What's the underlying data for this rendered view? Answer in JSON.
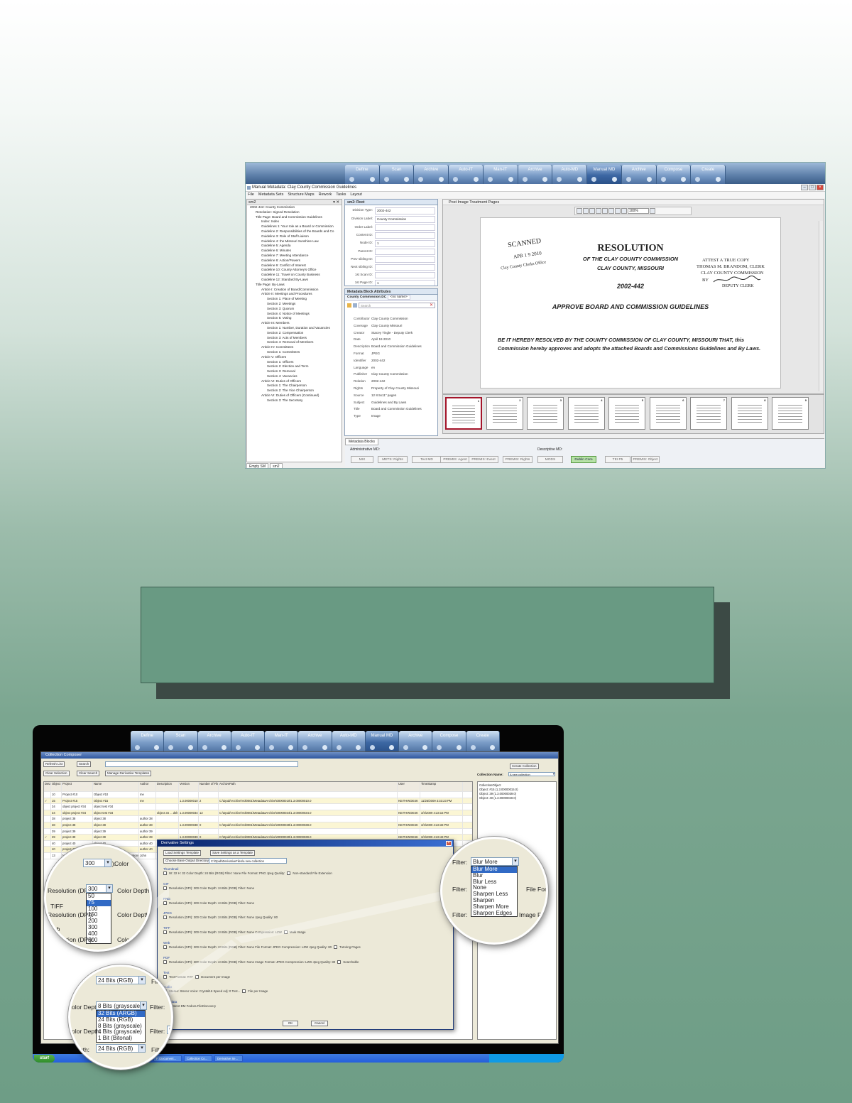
{
  "workflow_steps": [
    {
      "label": "Define",
      "dark": false
    },
    {
      "label": "Scan",
      "dark": false
    },
    {
      "label": "Archive",
      "dark": false
    },
    {
      "label": "Auto-IT",
      "dark": false
    },
    {
      "label": "Man-IT",
      "dark": false
    },
    {
      "label": "Archive",
      "dark": false
    },
    {
      "label": "Auto-MD",
      "dark": false
    },
    {
      "label": "Manual MD",
      "dark": true
    },
    {
      "label": "Archive",
      "dark": false
    },
    {
      "label": "Compose",
      "dark": false
    },
    {
      "label": "Create",
      "dark": false
    }
  ],
  "app1": {
    "window_title": "Manual Metadata: Clay County Commission Guidelines",
    "menu": [
      "File",
      "Metadata Sets",
      "Structure Maps",
      "Rework",
      "Tasks",
      "Layout"
    ],
    "tree_header": "sm2",
    "tree": [
      {
        "t": "2002-442: County Commission",
        "d": 1
      },
      {
        "t": "Resolution: Signed Resolution",
        "d": 2
      },
      {
        "t": "Title Page: Board and Commission Guidelines",
        "d": 2
      },
      {
        "t": "Index: Index",
        "d": 3
      },
      {
        "t": "Guidelines 1: Your role as a Board or Commission",
        "d": 3
      },
      {
        "t": "Guideline 2: Responsibilities of the Boards and Co",
        "d": 3
      },
      {
        "t": "Guideline 3: Role of Staff Liaison",
        "d": 3
      },
      {
        "t": "Guideline 4: the Missouri Sunshine Law",
        "d": 3
      },
      {
        "t": "Guideline 5: Agenda",
        "d": 3
      },
      {
        "t": "Guideline 6: Minutes",
        "d": 3
      },
      {
        "t": "Guideline 7: Meeting Attendance",
        "d": 3
      },
      {
        "t": "Guideline 8: Action/Powers",
        "d": 3
      },
      {
        "t": "Guideline 9: Conflict of Interest",
        "d": 3
      },
      {
        "t": "Guideline 10: County Attorney's Office",
        "d": 3
      },
      {
        "t": "Guideline 11: Travel on County Business",
        "d": 3
      },
      {
        "t": "Guideline 12: Standard By-Laws",
        "d": 3
      },
      {
        "t": "Title Page: By-Laws",
        "d": 2
      },
      {
        "t": "Article I: Creation of Board/Commission",
        "d": 3
      },
      {
        "t": "Article II: Meetings and Procedures",
        "d": 3
      },
      {
        "t": "Section 1: Place of Meeting",
        "d": 4
      },
      {
        "t": "Section 2: Meetings",
        "d": 4
      },
      {
        "t": "Section 3: Quorum",
        "d": 4
      },
      {
        "t": "Section 4: Notice of Meetings",
        "d": 4
      },
      {
        "t": "Section 5: Voting",
        "d": 4
      },
      {
        "t": "Article III: Members",
        "d": 3
      },
      {
        "t": "Section 1: Number, Duration and Vacancies",
        "d": 4
      },
      {
        "t": "Section 2: Compensation",
        "d": 4
      },
      {
        "t": "Section 3: Acts of Members",
        "d": 4
      },
      {
        "t": "Section 4: Removal of Members",
        "d": 4
      },
      {
        "t": "Article IV: Committees",
        "d": 3
      },
      {
        "t": "Section 1: Committees",
        "d": 4
      },
      {
        "t": "Article V: Officers",
        "d": 3
      },
      {
        "t": "Section 1: Officers",
        "d": 4
      },
      {
        "t": "Section 2: Election and Term",
        "d": 4
      },
      {
        "t": "Section 3: Removal",
        "d": 4
      },
      {
        "t": "Section 4: Vacancies",
        "d": 4
      },
      {
        "t": "Article VI: Duties of Officers",
        "d": 3
      },
      {
        "t": "Section 1: The Chairperson",
        "d": 4
      },
      {
        "t": "Section 2: The Vice Chairperson",
        "d": 4
      },
      {
        "t": "Article VI: Duties of Officers (Continued)",
        "d": 3
      },
      {
        "t": "Section 3: The Secretary",
        "d": 4
      }
    ],
    "tree_tabs": [
      "Empty SM",
      "sm2"
    ],
    "root_panel": {
      "title": "sm2: Root",
      "fields": [
        {
          "k": "Division Type:",
          "v": "2002-442"
        },
        {
          "k": "Division Label:",
          "v": "County Commission"
        },
        {
          "k": "Order Label:",
          "v": ""
        },
        {
          "k": "Content ID:",
          "v": ""
        },
        {
          "k": "Node ID:",
          "v": "1"
        },
        {
          "k": "Parent ID:",
          "v": ""
        },
        {
          "k": "Prev sibling ID:",
          "v": ""
        },
        {
          "k": "Next sibling ID:",
          "v": ""
        },
        {
          "k": "1st Scan ID:",
          "v": ""
        },
        {
          "k": "1st Page ID:",
          "v": "1"
        }
      ]
    },
    "block_panel": {
      "title": "Metadata Block Attributes",
      "tab": "County Commission:DC",
      "name_placeholder": "<no name>",
      "search_placeholder": "Search",
      "fields": [
        {
          "k": "Contributor",
          "v": "Clay County Commission"
        },
        {
          "k": "Coverage",
          "v": "Clay County Missouri"
        },
        {
          "k": "Creator",
          "v": "Stacey Tingle - Deputy Clerk"
        },
        {
          "k": "Date",
          "v": "April 19 2010"
        },
        {
          "k": "Description",
          "v": "Board and Commission Guidelines"
        },
        {
          "k": "Format",
          "v": "JPEG"
        },
        {
          "k": "Identifier",
          "v": "2002-442"
        },
        {
          "k": "Language",
          "v": "en"
        },
        {
          "k": "Publisher",
          "v": "Clay County Commission"
        },
        {
          "k": "Relation",
          "v": "2002-442"
        },
        {
          "k": "Rights",
          "v": "Property of Clay County Missouri"
        },
        {
          "k": "Source",
          "v": "12 8.5x11\" pages"
        },
        {
          "k": "Subject",
          "v": "Guidelines and By Laws"
        },
        {
          "k": "Title",
          "v": "Board and Commission Guidelines"
        },
        {
          "k": "Type",
          "v": "Image"
        }
      ]
    },
    "viewer": {
      "title": "Post Image Treatment Pages",
      "zoom": "100%",
      "document": {
        "stamp1": "SCANNED",
        "stamp2": "APR 1 9 2010",
        "stamp3": "Clay County Clerks Office",
        "heading": "RESOLUTION",
        "sub1": "OF THE CLAY COUNTY COMMISSION",
        "sub2": "CLAY COUNTY, MISSOURI",
        "number": "2002-442",
        "attest1": "ATTEST A TRUE COPY",
        "attest2": "THOMAS M. BRANDOM, CLERK",
        "attest3": "CLAY COUNTY COMMISSION",
        "attest4": "BY",
        "attest5": "DEPUTY CLERK",
        "approve": "APPROVE BOARD AND COMMISSION GUIDELINES",
        "body": "BE IT HEREBY RESOLVED BY THE COUNTY COMMISSION OF CLAY COUNTY, MISSOURI THAT, this Commission hereby approves and adopts the attached Boards and Commissions Guidelines and By Laws."
      },
      "thumb_numbers": [
        "1",
        "2",
        "3",
        "4",
        "5",
        "6",
        "7",
        "8",
        "9"
      ]
    },
    "metadata_blocks": {
      "tab": "Metadata Blocks",
      "admin_label": "Administrative MD:",
      "desc_label": "Descriptive MD:",
      "admin": [
        "MIX",
        "METS: Rights",
        "Text MD",
        "PREMIS: Agent",
        "PREMIS: Event",
        "PREMIS: Rights"
      ],
      "desc": [
        {
          "l": "MODS",
          "s": false
        },
        {
          "l": "Dublin Core",
          "s": true
        },
        {
          "l": "TEI P5",
          "s": false
        },
        {
          "l": "PREMIS: Object",
          "s": false
        }
      ]
    }
  },
  "app2": {
    "window_title": "Collection Composer",
    "buttons": {
      "refresh": "Refresh List",
      "search": "Search",
      "clear_selection": "Clear Selection",
      "clear_search": "Clear Search",
      "manage": "Manage Derivative Templates",
      "create": "Create Collection"
    },
    "collection_name_label": "Collection Name:",
    "collection_name_value": "A new collection",
    "columns": [
      "Detail",
      "Object ID",
      "Project",
      "Name",
      "Author",
      "Description",
      "Version",
      "Number of Files",
      "ArchivePath",
      "User",
      "TimeStamp"
    ],
    "rows": [
      [
        "",
        "10",
        "Project #10",
        "Object #10",
        "me",
        "",
        "",
        "",
        "",
        "",
        ""
      ],
      [
        "✓",
        "15",
        "Project #15",
        "Object #15",
        "me",
        "",
        "1.3.00000010.0",
        "2",
        "C:\\Dpub\\Archive\\Vol0001\\MetadataArchive\\00000010\\1.3.00000010.0",
        "KEITHWOESK",
        "11/25/2009 3:33:23 PM"
      ],
      [
        "",
        "34",
        "object project #34",
        "object test #34",
        "",
        "",
        "",
        "",
        "",
        "",
        ""
      ],
      [
        "",
        "34",
        "object project #34",
        "object test #34",
        "",
        "object 34 ... dsh",
        "1.3.00000034.0",
        "12",
        "C:\\Dpub\\Archive\\Vol0001\\MetadataArchive\\00000034\\1.3.00000034.0",
        "KEITHWOESK",
        "3/4/2009 4:23:15 PM"
      ],
      [
        "",
        "38",
        "project 38",
        "object 38",
        "author 38",
        "",
        "",
        "",
        "",
        "",
        ""
      ],
      [
        "",
        "38",
        "project 38",
        "object 38",
        "author 38",
        "",
        "1.3.00000038.0",
        "0",
        "C:\\Dpub\\Archive\\Vol0001\\MetadataArchive\\00000038\\1.3.00000038.0",
        "KEITHWOESK",
        "3/4/2009 4:23:33 PM"
      ],
      [
        "",
        "39",
        "project 39",
        "object 39",
        "author 39",
        "",
        "",
        "",
        "",
        "",
        ""
      ],
      [
        "✓",
        "39",
        "project 39",
        "object 39",
        "author 39",
        "",
        "1.3.00000039.0",
        "0",
        "C:\\Dpub\\Archive\\Vol0001\\MetadataArchive\\00000039\\1.3.00000039.0",
        "KEITHWOESK",
        "3/4/2009 4:23:43 PM"
      ],
      [
        "",
        "40",
        "project 40",
        "object 40",
        "author 40",
        "",
        "",
        "",
        "",
        "",
        ""
      ],
      [
        "",
        "40",
        "project 40",
        "object 40",
        "author 40",
        "",
        "",
        "",
        "",
        "",
        ""
      ],
      [
        "",
        "13",
        "Microsoft Visual Studio",
        "8 Managing Errors and Exceptions",
        "John",
        "",
        "",
        "",
        "",
        "",
        ""
      ]
    ],
    "right_panel": [
      "CollectionObject",
      "Object: #15 (1.3.00000015.0)",
      "Object: 39 (1.3.00000039.0)",
      "Object: 40 (1.3.00000040.0)"
    ],
    "taskbar": {
      "start": "start",
      "items": [
        "Hero Servers",
        "F:\\Document...",
        "Collection Co...",
        "Derivative Se..."
      ]
    }
  },
  "dialog": {
    "title": "Derivative Settings",
    "load": "Load Settings Template",
    "save": "Save Settings as a Template",
    "choose": "Choose Base Output Directory",
    "path": "C:\\Dpub\\DerivativeFiles\\a new collection",
    "sections": [
      {
        "name": "Thumbnail",
        "fields": "W: 32  H: 32  Color Depth: 24 Bits (RGB)  Filter: None  File Format: PNG  Jpeg Quality:",
        "extra": "Non-standard File Extension"
      },
      {
        "name": "GIF",
        "fields": "Resolution (DPI): 300  Color Depth: 24 Bits (RGB)  Filter: None",
        "extra": ""
      },
      {
        "name": "PNG",
        "fields": "Resolution (DPI): 300  Color Depth: 24 Bits (RGB)  Filter: None",
        "extra": ""
      },
      {
        "name": "JPEG",
        "fields": "Resolution (DPI): 300  Color Depth: 24 Bits (RGB)  Filter: None  Jpeg Quality: 80",
        "extra": ""
      },
      {
        "name": "TIFF",
        "fields": "Resolution (DPI): 300  Color Depth: 24 Bits (RGB)  Filter: None  Compression: LZW",
        "extra": "Multi Image"
      },
      {
        "name": "Web",
        "fields": "Resolution (DPI): 300  Color Depth: 24 Bits (RGB)  Filter: None  File Format: JPEG  Compression: LZW  Jpeg Quality: 80",
        "extra": "Tutoring Pages"
      },
      {
        "name": "PDF",
        "fields": "Resolution (DPI): 300  Color Depth: 24 Bits (RGB)  Filter: None  Image Format: JPEG  Compression: LZW  Jpeg Quality: 80",
        "extra": "Searchable"
      },
      {
        "name": "Text",
        "fields": "Text Format: RTF",
        "extra": "Document per Image"
      },
      {
        "name": "Audio",
        "fields": "Stereo: Stereo  Voice: Crystal16  Speed Adj: 0  Test...",
        "extra": "File per Image"
      },
      {
        "name": "Metadata",
        "fields": "Content DM   Fedora   FileDiscovery",
        "extra": ""
      }
    ],
    "ok": "OK",
    "cancel": "Cancel"
  },
  "zoom_left": {
    "dpi_label_prefix": "Resolution (DPI):",
    "dpi_selected": "300",
    "dpi_options": [
      "50",
      "75",
      "100",
      "150",
      "200",
      "300",
      "400",
      "600"
    ],
    "dpi_highlight": "75",
    "color_depth_label": "Color Depth:",
    "tiff_label": "TIFF",
    "web_label": "Web"
  },
  "zoom_bottom": {
    "color_depth_label": "Color Depth:",
    "selected": "24 Bits (RGB)",
    "dropdown_selected": "8 Bits (grayscale)",
    "options": [
      "32 Bits (ARGB)",
      "24 Bits (RGB)",
      "8 Bits (grayscale)",
      "4 Bits (grayscale)",
      "1 Bit (Bitonal)"
    ],
    "highlight": "32 Bits (ARGB)",
    "filter_label": "Filter:",
    "filter_value": "None"
  },
  "zoom_right": {
    "filter_label": "Filter:",
    "selected": "Blur More",
    "options": [
      "Blur More",
      "Blur",
      "Blur Less",
      "None",
      "Sharpen Less",
      "Sharpen",
      "Sharpen More",
      "Sharpen Edges"
    ],
    "highlight": "Blur More",
    "file_format_label": "File For",
    "image_label": "Image F"
  }
}
